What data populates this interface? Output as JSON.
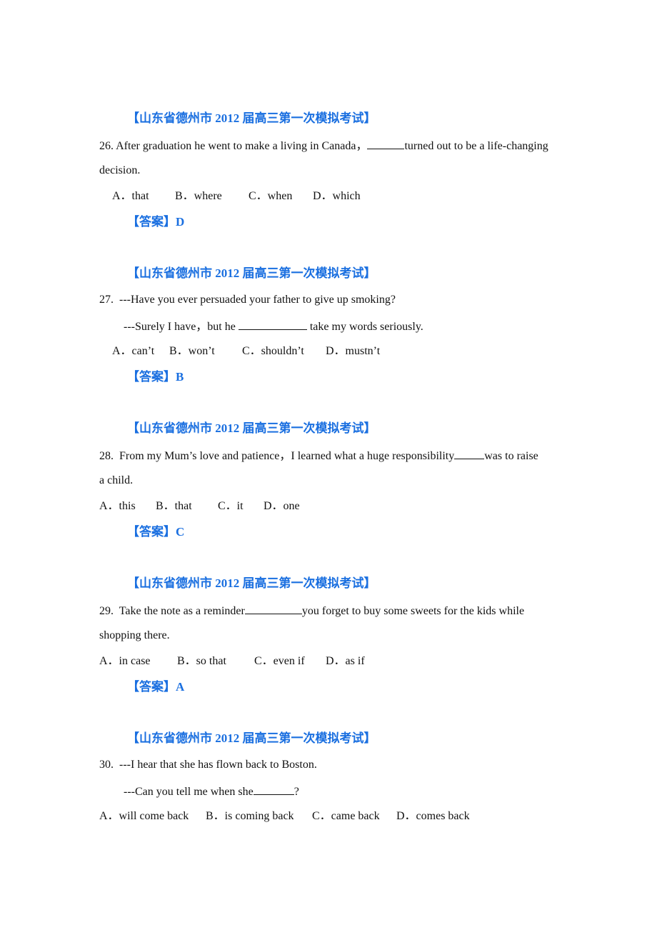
{
  "questions": [
    {
      "source": "【山东省德州市 2012 届高三第一次模拟考试】",
      "number": "26.",
      "text_before": "After graduation he went to make a living in Canada，",
      "text_after": "turned out to be a life-changing",
      "text_line2": "decision.",
      "options": [
        "A．that",
        "B．where",
        "C．when",
        "D．which"
      ],
      "answer_label": "【答案】",
      "answer": "D"
    },
    {
      "source": "【山东省德州市 2012 届高三第一次模拟考试】",
      "number": "27.",
      "line1": "---Have you ever persuaded your father to give up smoking?",
      "line2_before": "---Surely I have，but he ",
      "line2_after": " take my words seriously.",
      "options": [
        "A．can’t",
        "B．won’t",
        "C．shouldn’t",
        "D．mustn’t"
      ],
      "answer_label": "【答案】",
      "answer": "B"
    },
    {
      "source": "【山东省德州市 2012 届高三第一次模拟考试】",
      "number": "28.",
      "text_before": "From my Mum’s love and patience，I learned what a huge responsibility",
      "text_after": "was to raise",
      "text_line2": "a child.",
      "options": [
        "A．this",
        "B．that",
        "C．it",
        "D．one"
      ],
      "answer_label": "【答案】",
      "answer": "C"
    },
    {
      "source": "【山东省德州市 2012 届高三第一次模拟考试】",
      "number": "29.",
      "text_before": "Take the note as a reminder",
      "text_after": "you forget to buy some sweets for the kids while",
      "text_line2": "shopping there.",
      "options": [
        "A．in case",
        "B．so that",
        "C．even if",
        "D．as if"
      ],
      "answer_label": "【答案】",
      "answer": "A"
    },
    {
      "source": "【山东省德州市 2012 届高三第一次模拟考试】",
      "number": "30.",
      "line1": "---I hear that she has flown back to Boston.",
      "line2_before": "---Can you tell me when she",
      "line2_after": "?",
      "options": [
        "A．will come back",
        "B．is coming back",
        "C．came back",
        "D．comes back"
      ]
    }
  ]
}
